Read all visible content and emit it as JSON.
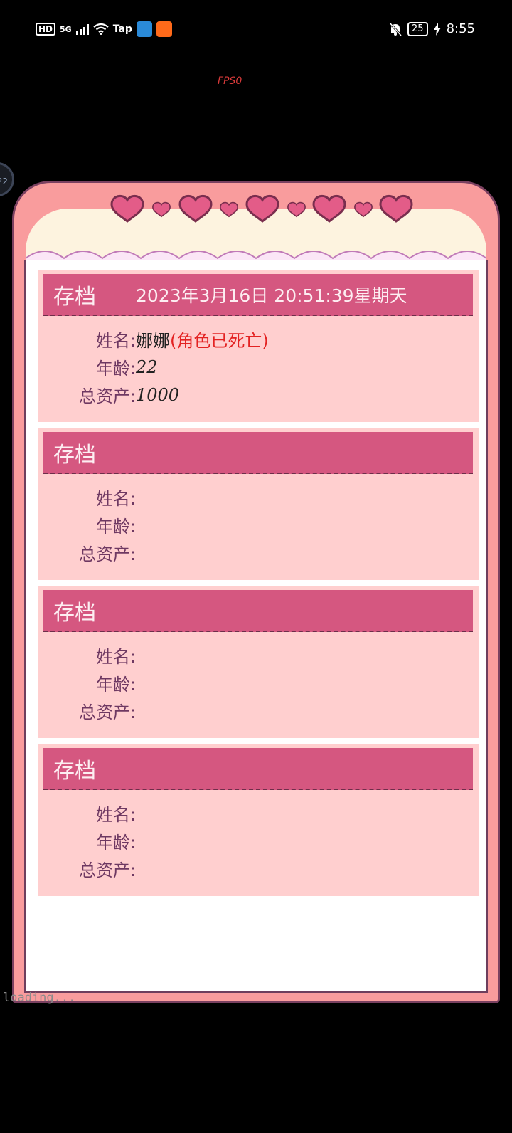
{
  "status_bar": {
    "hd": "HD",
    "network": "5G",
    "tap": "Tap",
    "battery": "25",
    "time": "8:55"
  },
  "overlay": {
    "fps": "FPS0",
    "loading": "loading...",
    "left_circle": "22"
  },
  "slots": [
    {
      "title": "存档",
      "date": "2023年3月16日 20:51:39星期天",
      "name_label": "姓名:",
      "name_value": "娜娜",
      "name_status": "(角色已死亡)",
      "age_label": "年龄:",
      "age_value": "22",
      "assets_label": "总资产:",
      "assets_value": "1000"
    },
    {
      "title": "存档",
      "date": "",
      "name_label": "姓名:",
      "name_value": "",
      "name_status": "",
      "age_label": "年龄:",
      "age_value": "",
      "assets_label": "总资产:",
      "assets_value": ""
    },
    {
      "title": "存档",
      "date": "",
      "name_label": "姓名:",
      "name_value": "",
      "name_status": "",
      "age_label": "年龄:",
      "age_value": "",
      "assets_label": "总资产:",
      "assets_value": ""
    },
    {
      "title": "存档",
      "date": "",
      "name_label": "姓名:",
      "name_value": "",
      "name_status": "",
      "age_label": "年龄:",
      "age_value": "",
      "assets_label": "总资产:",
      "assets_value": ""
    }
  ],
  "colors": {
    "frame": "#f99c9d",
    "header_bar": "#d55780",
    "slot_bg": "#ffcfcf",
    "dead_text": "#e32222"
  }
}
